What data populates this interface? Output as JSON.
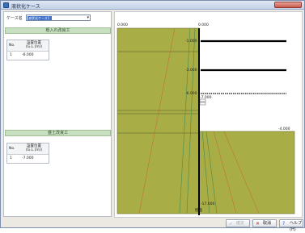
{
  "window": {
    "title": "液状化ケース"
  },
  "case": {
    "label": "ケース名",
    "selected": "液状化ケース1"
  },
  "upper_section": {
    "title": "根入れ改良工",
    "col_no": "No.",
    "col_header_1": "設置位置",
    "col_header_2": "(G.L.(m))",
    "rows": [
      {
        "no": "1",
        "value": "-6.000"
      }
    ]
  },
  "lower_section": {
    "title": "盛土改良工",
    "col_no": "No.",
    "col_header_1": "設置位置",
    "col_header_2": "(G.L.(m))",
    "rows": [
      {
        "no": "1",
        "value": "-7.000"
      }
    ]
  },
  "diagram": {
    "top_left_label": "0.000",
    "top_mid_label": "0.000",
    "right_ground_label": "-4.000",
    "levels": [
      "-1.000",
      "-3.000",
      "-6.000",
      "-7.000"
    ],
    "bottom_label": "-17.000",
    "wall_label": "壁面",
    "soil_color": "#a9ad45",
    "line_color": "#000000"
  },
  "buttons": {
    "confirm": "確定",
    "cancel": "取消",
    "help": "ヘルプ(H)"
  }
}
